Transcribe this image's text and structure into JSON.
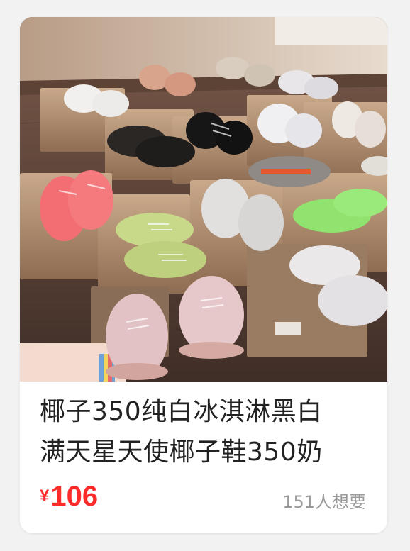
{
  "product": {
    "title_line_1": "椰子350纯白冰淇淋黑白",
    "title_line_2": "满天星天使椰子鞋350奶",
    "price_currency": "¥",
    "price_amount": "106",
    "wants_text": "151人想要"
  },
  "colors": {
    "price": "#ff2b2b",
    "wants": "#9a9a9a",
    "title": "#222222",
    "card": "#ffffff",
    "page_bg": "#f2f2f2"
  },
  "image": {
    "subject": "sneaker-collection-photo"
  }
}
